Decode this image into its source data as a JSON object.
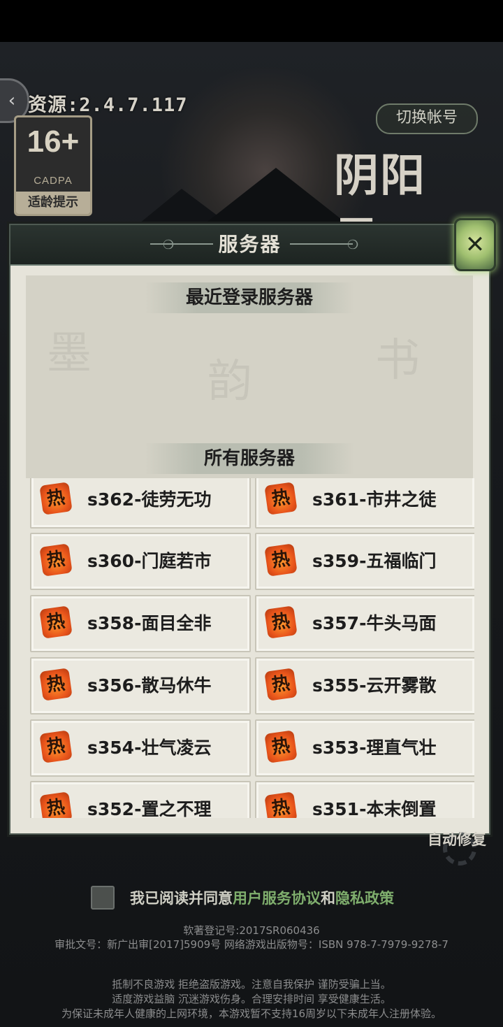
{
  "header": {
    "version": "资源:2.4.7.117",
    "switch_account": "切换帐号",
    "logo": "阴阳界"
  },
  "age_badge": {
    "number": "16+",
    "org": "CADPA",
    "tip": "适龄提示"
  },
  "panel": {
    "title": "服务器",
    "recent_title": "最近登录服务器",
    "all_title": "所有服务器",
    "close_icon": "close-icon"
  },
  "servers": [
    {
      "hot": "热",
      "name": "s362-徒劳无功"
    },
    {
      "hot": "热",
      "name": "s361-市井之徒"
    },
    {
      "hot": "热",
      "name": "s360-门庭若市"
    },
    {
      "hot": "热",
      "name": "s359-五福临门"
    },
    {
      "hot": "热",
      "name": "s358-面目全非"
    },
    {
      "hot": "热",
      "name": "s357-牛头马面"
    },
    {
      "hot": "热",
      "name": "s356-散马休牛"
    },
    {
      "hot": "热",
      "name": "s355-云开雾散"
    },
    {
      "hot": "热",
      "name": "s354-壮气凌云"
    },
    {
      "hot": "热",
      "name": "s353-理直气壮"
    },
    {
      "hot": "热",
      "name": "s352-置之不理"
    },
    {
      "hot": "热",
      "name": "s351-本末倒置"
    }
  ],
  "auto_fix": "自动修复",
  "agreement": {
    "prefix": "我已阅读并同意",
    "user_agreement": "用户服务协议",
    "and": "和",
    "privacy_policy": "隐私政策"
  },
  "footer": {
    "software_reg": "软著登记号:2017SR060436",
    "approval": "审批文号：新广出审[2017]5909号   网络游戏出版物号：ISBN 978-7-7979-9278-7",
    "advice1": "抵制不良游戏   拒绝盗版游戏。注意自我保护   谨防受骗上当。",
    "advice2": "适度游戏益脑   沉迷游戏伤身。合理安排时间   享受健康生活。",
    "advice3": "为保证未成年人健康的上网环境，本游戏暂不支持16周岁以下未成年人注册体验。"
  },
  "colors": {
    "panel_bg": "#e6e4da",
    "header_bg": "#1d2421",
    "hot_badge": "#e8541b",
    "link": "#7fae6d"
  }
}
